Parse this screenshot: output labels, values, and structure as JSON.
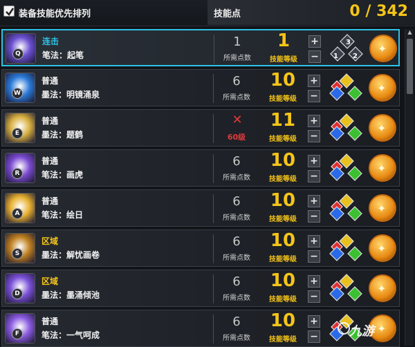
{
  "header": {
    "sort_label": "装备技能优先排列",
    "sort_checked": true,
    "skill_points_label": "技能点",
    "skill_points_value": "0 / 342"
  },
  "labels": {
    "cost_label": "所需点数",
    "level_label": "技能等级",
    "plus": "+",
    "minus": "−"
  },
  "skills": [
    {
      "key": "Q",
      "type": "连击",
      "type_color": "cyan",
      "name": "笔法：起笔",
      "cost": "1",
      "level": "1",
      "selected": true,
      "icon_color": "#6a4fd0",
      "gem_numbers": [
        "3",
        "1",
        "2"
      ]
    },
    {
      "key": "W",
      "type": "普通",
      "type_color": "white",
      "name": "墨法：明镜涌泉",
      "cost": "6",
      "level": "10",
      "selected": false,
      "icon_color": "#2a7ad8"
    },
    {
      "key": "E",
      "type": "普通",
      "type_color": "white",
      "name": "墨法：题鹤",
      "cost": "",
      "lock_text": "60级",
      "level": "11",
      "selected": false,
      "icon_color": "#d8b040"
    },
    {
      "key": "R",
      "type": "普通",
      "type_color": "white",
      "name": "笔法：画虎",
      "cost": "6",
      "level": "10",
      "selected": false,
      "icon_color": "#7a4ad0"
    },
    {
      "key": "A",
      "type": "普通",
      "type_color": "white",
      "name": "笔法：绘日",
      "cost": "6",
      "level": "10",
      "selected": false,
      "icon_color": "#e8b030"
    },
    {
      "key": "S",
      "type": "区域",
      "type_color": "yellow",
      "name": "墨法：解忧画卷",
      "cost": "6",
      "level": "10",
      "selected": false,
      "icon_color": "#c08020"
    },
    {
      "key": "D",
      "type": "区域",
      "type_color": "yellow",
      "name": "墨法：墨涌倾池",
      "cost": "6",
      "level": "10",
      "selected": false,
      "icon_color": "#7a50d8"
    },
    {
      "key": "F",
      "type": "普通",
      "type_color": "white",
      "name": "笔法：一气呵成",
      "cost": "6",
      "level": "10",
      "selected": false,
      "icon_color": "#8a5ae0"
    }
  ],
  "watermark": "九游"
}
